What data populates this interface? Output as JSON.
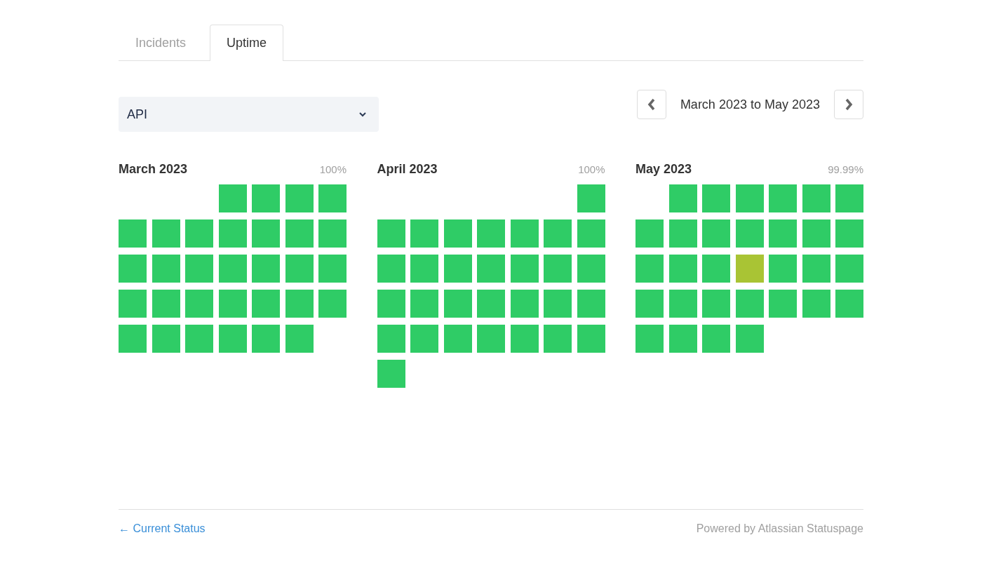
{
  "tabs": [
    {
      "label": "Incidents",
      "selected": false
    },
    {
      "label": "Uptime",
      "selected": true
    }
  ],
  "component_select": {
    "value": "API"
  },
  "date_range": {
    "label": "March 2023 to May 2023"
  },
  "months": [
    {
      "title": "March 2023",
      "uptime": "100%",
      "days": [
        {
          "kind": "blank"
        },
        {
          "kind": "blank"
        },
        {
          "kind": "blank"
        },
        {
          "color": "#2fcc66"
        },
        {
          "color": "#2fcc66"
        },
        {
          "color": "#2fcc66"
        },
        {
          "color": "#2fcc66"
        },
        {
          "color": "#2fcc66"
        },
        {
          "color": "#2fcc66"
        },
        {
          "color": "#2fcc66"
        },
        {
          "color": "#2fcc66"
        },
        {
          "color": "#2fcc66"
        },
        {
          "color": "#2fcc66"
        },
        {
          "color": "#2fcc66"
        },
        {
          "color": "#2fcc66"
        },
        {
          "color": "#2fcc66"
        },
        {
          "color": "#2fcc66"
        },
        {
          "color": "#2fcc66"
        },
        {
          "color": "#2fcc66"
        },
        {
          "color": "#2fcc66"
        },
        {
          "color": "#2fcc66"
        },
        {
          "color": "#2fcc66"
        },
        {
          "color": "#2fcc66"
        },
        {
          "color": "#2fcc66"
        },
        {
          "color": "#2fcc66"
        },
        {
          "color": "#2fcc66"
        },
        {
          "color": "#2fcc66"
        },
        {
          "color": "#2fcc66"
        },
        {
          "color": "#2fcc66"
        },
        {
          "color": "#2fcc66"
        },
        {
          "color": "#2fcc66"
        },
        {
          "color": "#2fcc66"
        },
        {
          "color": "#2fcc66"
        },
        {
          "color": "#2fcc66"
        }
      ]
    },
    {
      "title": "April 2023",
      "uptime": "100%",
      "days": [
        {
          "kind": "blank"
        },
        {
          "kind": "blank"
        },
        {
          "kind": "blank"
        },
        {
          "kind": "blank"
        },
        {
          "kind": "blank"
        },
        {
          "kind": "blank"
        },
        {
          "color": "#2fcc66"
        },
        {
          "color": "#2fcc66"
        },
        {
          "color": "#2fcc66"
        },
        {
          "color": "#2fcc66"
        },
        {
          "color": "#2fcc66"
        },
        {
          "color": "#2fcc66"
        },
        {
          "color": "#2fcc66"
        },
        {
          "color": "#2fcc66"
        },
        {
          "color": "#2fcc66"
        },
        {
          "color": "#2fcc66"
        },
        {
          "color": "#2fcc66"
        },
        {
          "color": "#2fcc66"
        },
        {
          "color": "#2fcc66"
        },
        {
          "color": "#2fcc66"
        },
        {
          "color": "#2fcc66"
        },
        {
          "color": "#2fcc66"
        },
        {
          "color": "#2fcc66"
        },
        {
          "color": "#2fcc66"
        },
        {
          "color": "#2fcc66"
        },
        {
          "color": "#2fcc66"
        },
        {
          "color": "#2fcc66"
        },
        {
          "color": "#2fcc66"
        },
        {
          "color": "#2fcc66"
        },
        {
          "color": "#2fcc66"
        },
        {
          "color": "#2fcc66"
        },
        {
          "color": "#2fcc66"
        },
        {
          "color": "#2fcc66"
        },
        {
          "color": "#2fcc66"
        },
        {
          "color": "#2fcc66"
        },
        {
          "color": "#2fcc66"
        }
      ]
    },
    {
      "title": "May 2023",
      "uptime": "99.99%",
      "days": [
        {
          "kind": "blank"
        },
        {
          "color": "#2fcc66"
        },
        {
          "color": "#2fcc66"
        },
        {
          "color": "#2fcc66"
        },
        {
          "color": "#2fcc66"
        },
        {
          "color": "#2fcc66"
        },
        {
          "color": "#2fcc66"
        },
        {
          "color": "#2fcc66"
        },
        {
          "color": "#2fcc66"
        },
        {
          "color": "#2fcc66"
        },
        {
          "color": "#2fcc66"
        },
        {
          "color": "#2fcc66"
        },
        {
          "color": "#2fcc66"
        },
        {
          "color": "#2fcc66"
        },
        {
          "color": "#2fcc66"
        },
        {
          "color": "#2fcc66"
        },
        {
          "color": "#2fcc66"
        },
        {
          "color": "#a9c434"
        },
        {
          "color": "#2fcc66"
        },
        {
          "color": "#2fcc66"
        },
        {
          "color": "#2fcc66"
        },
        {
          "color": "#2fcc66"
        },
        {
          "color": "#2fcc66"
        },
        {
          "color": "#2fcc66"
        },
        {
          "color": "#2fcc66"
        },
        {
          "color": "#2fcc66"
        },
        {
          "color": "#2fcc66"
        },
        {
          "color": "#2fcc66"
        },
        {
          "color": "#2fcc66"
        },
        {
          "color": "#2fcc66"
        },
        {
          "color": "#2fcc66"
        },
        {
          "color": "#2fcc66"
        }
      ]
    }
  ],
  "footer": {
    "back_link": "← Current Status",
    "powered_by": "Powered by Atlassian Statuspage"
  }
}
